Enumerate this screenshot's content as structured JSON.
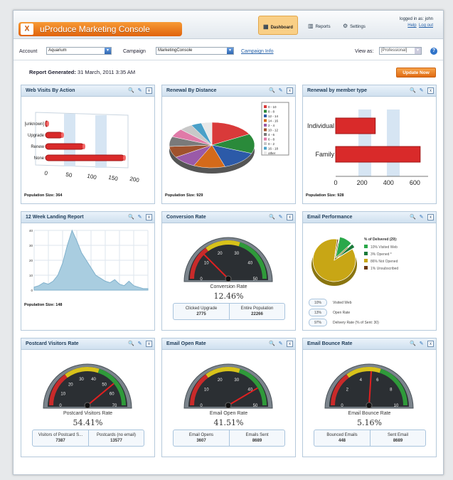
{
  "app": {
    "title": "uProduce Marketing Console",
    "logo_icon": "xmpie-logo"
  },
  "nav": {
    "dashboard": "Dashboard",
    "reports": "Reports",
    "settings": "Settings"
  },
  "user": {
    "logged_in": "logged in as: john",
    "help": "Help",
    "logout": "Log out"
  },
  "filters": {
    "account_label": "Account",
    "account_value": "Aquarium",
    "campaign_label": "Campaign",
    "campaign_value": "MarketingConsole",
    "campaign_info": "Campaign Info",
    "viewas_label": "View as:",
    "viewas_value": "[Professional]"
  },
  "report": {
    "generated_label": "Report Generated:",
    "generated_value": "31 March, 2011 3:35 AM",
    "update_button": "Update Now"
  },
  "panels": {
    "web_visits": {
      "title": "Web Visits By Action",
      "population": "Population Size: 364"
    },
    "renewal_distance": {
      "title": "Renewal By Distance",
      "population": "Population Size: 929"
    },
    "renewal_member": {
      "title": "Renewal by member type",
      "population": "Population Size: 928"
    },
    "landing": {
      "title": "12 Week Landing Report",
      "population": "Population Size: 148"
    },
    "conversion": {
      "title": "Conversion Rate",
      "gauge_label": "Conversion Rate",
      "value": "12.46%",
      "c1_label": "Clicked Upgrade",
      "c1_value": "2775",
      "c2_label": "Entire Population",
      "c2_value": "22266",
      "ticks": [
        "0",
        "10",
        "20",
        "30",
        "40",
        "50"
      ]
    },
    "email_perf": {
      "title": "Email Performance",
      "legend_title": "% of Delivered (29):",
      "legend": [
        {
          "label": "10%  Visited Web",
          "color": "#2aa84a"
        },
        {
          "label": "3%  Opened *",
          "color": "#1a7a3a"
        },
        {
          "label": "86%  Not Opened",
          "color": "#c8a615"
        },
        {
          "label": "1%  Unsubscribed",
          "color": "#6b3a12"
        }
      ],
      "stats": [
        {
          "pill": "10%",
          "label": "Visited Web"
        },
        {
          "pill": "13%",
          "label": "Open Rate"
        },
        {
          "pill": "97%",
          "label": "Delivery Rate (% of Sent: 30)"
        }
      ]
    },
    "postcard": {
      "title": "Postcard Visitors Rate",
      "gauge_label": "Postcard Visitors Rate",
      "value": "54.41%",
      "c1_label": "Visitors of Postcard S...",
      "c1_value": "7387",
      "c2_label": "Postcards (no email)",
      "c2_value": "13577",
      "ticks": [
        "0",
        "10",
        "20",
        "30",
        "40",
        "50",
        "60",
        "70"
      ]
    },
    "email_open": {
      "title": "Email Open Rate",
      "gauge_label": "Email Open Rate",
      "value": "41.51%",
      "c1_label": "Email Opens",
      "c1_value": "3607",
      "c2_label": "Emails Sent",
      "c2_value": "8689",
      "ticks": [
        "0",
        "10",
        "20",
        "30",
        "40",
        "50"
      ]
    },
    "email_bounce": {
      "title": "Email Bounce Rate",
      "gauge_label": "Email Bounce Rate",
      "value": "5.16%",
      "c1_label": "Bounced Emails",
      "c1_value": "448",
      "c2_label": "Sent Email",
      "c2_value": "8689",
      "ticks": [
        "0",
        "2",
        "4",
        "6",
        "8",
        "10"
      ]
    }
  },
  "chart_data": [
    {
      "type": "bar",
      "title": "Web Visits By Action",
      "orientation": "horizontal",
      "categories": [
        "[unknown]",
        "Upgrade",
        "Renew",
        "None"
      ],
      "values": [
        5,
        40,
        90,
        185
      ],
      "xlim": [
        0,
        200
      ],
      "xticks": [
        "0",
        "50",
        "100",
        "150",
        "200"
      ]
    },
    {
      "type": "pie",
      "title": "Renewal By Distance",
      "legend": [
        "0 - 10",
        "8 - 8",
        "12 - 14",
        "14 - 16",
        "2 - 4",
        "10 - 12",
        "4 - 6",
        "6 - 8",
        "0 - 2",
        "16 - 18",
        "other"
      ],
      "values": [
        17,
        14,
        14,
        12,
        9,
        8,
        7,
        6,
        5,
        4,
        4
      ],
      "colors": [
        "#d93a3a",
        "#2a8a3a",
        "#2c5aa8",
        "#d46a1a",
        "#9a5aa8",
        "#a0522d",
        "#7a7a7a",
        "#e07aa8",
        "#c8c8c8",
        "#4aa0c8",
        "#e8e8e8"
      ]
    },
    {
      "type": "bar",
      "title": "Renewal by member type",
      "orientation": "horizontal",
      "categories": [
        "Individual",
        "Family"
      ],
      "values": [
        300,
        640
      ],
      "xlim": [
        0,
        700
      ],
      "xticks": [
        "0",
        "200",
        "400",
        "600"
      ]
    },
    {
      "type": "area",
      "title": "12 Week Landing Report",
      "x": [
        1,
        2,
        3,
        4,
        5,
        6,
        7,
        8,
        9,
        10,
        11,
        12,
        13,
        14,
        15,
        16,
        17,
        18,
        19,
        20,
        21,
        22,
        23,
        24,
        25
      ],
      "values": [
        2,
        3,
        5,
        4,
        6,
        10,
        18,
        30,
        40,
        33,
        25,
        20,
        15,
        10,
        8,
        6,
        5,
        7,
        4,
        3,
        6,
        3,
        2,
        1,
        1
      ],
      "ylim": [
        0,
        40
      ],
      "yticks": [
        "0",
        "10",
        "20",
        "30",
        "40"
      ]
    },
    {
      "type": "pie",
      "title": "Email Performance",
      "values": [
        10,
        3,
        86,
        1
      ],
      "colors": [
        "#2aa84a",
        "#1a7a3a",
        "#c8a615",
        "#6b3a12"
      ]
    }
  ]
}
